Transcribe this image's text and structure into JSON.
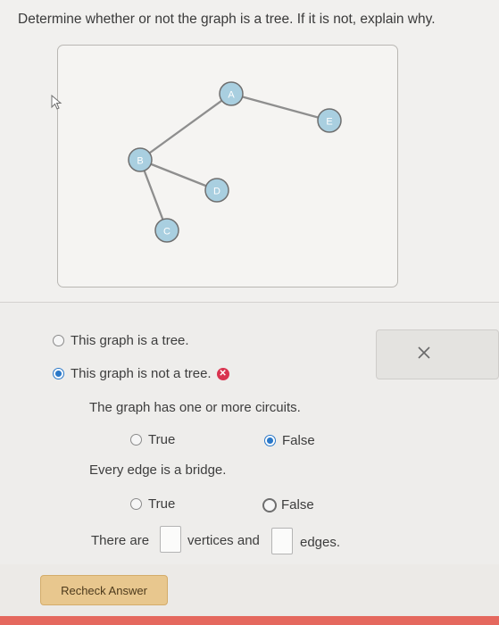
{
  "question": "Determine whether or not the graph is a tree. If it is not, explain why.",
  "graph": {
    "node_labels": [
      "A",
      "B",
      "C",
      "D",
      "E"
    ],
    "edges": [
      [
        "A",
        "B"
      ],
      [
        "A",
        "E"
      ],
      [
        "B",
        "D"
      ],
      [
        "B",
        "C"
      ]
    ],
    "node_color": "#a9cfe0",
    "edge_color": "#8e8e8e"
  },
  "choices": {
    "is_tree": "This graph is a tree.",
    "not_tree": "This graph is not a tree.",
    "selected": "not_tree"
  },
  "sub1": {
    "statement": "The graph has one or more circuits.",
    "true_label": "True",
    "false_label": "False",
    "selected": "False"
  },
  "sub2": {
    "statement": "Every edge is a bridge.",
    "true_label": "True",
    "false_label": "False",
    "selected": "False"
  },
  "count": {
    "prefix": "There are",
    "middle": "vertices and",
    "suffix": "edges.",
    "vertices_value": "",
    "edges_value": ""
  },
  "recheck_label": "Recheck Answer",
  "colors": {
    "selected_radio": "#2a78c8",
    "wrong_icon": "#d9334f",
    "recheck_button": "#e8c78e",
    "bottom_strip": "#e5685e"
  }
}
